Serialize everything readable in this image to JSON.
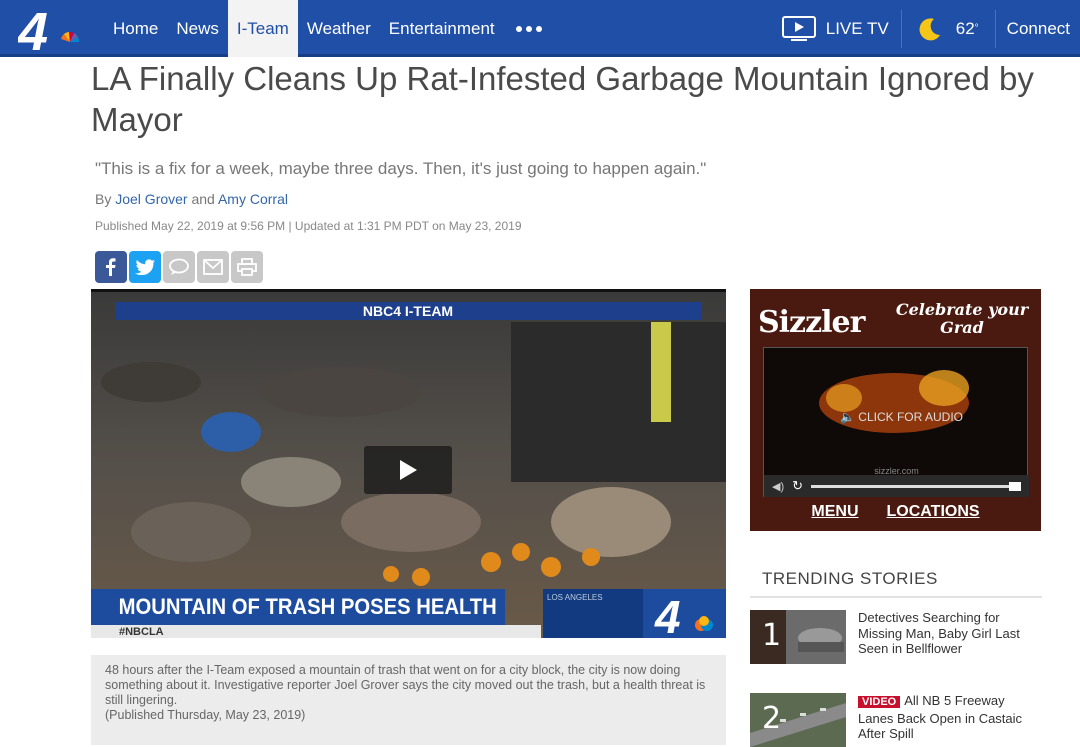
{
  "nav": {
    "items": [
      {
        "label": "Home"
      },
      {
        "label": "News"
      },
      {
        "label": "I-Team"
      },
      {
        "label": "Weather"
      },
      {
        "label": "Entertainment"
      }
    ],
    "active": "I-Team",
    "live_tv": "LIVE TV",
    "temperature": "62",
    "temperature_unit": "°",
    "connect": "Connect",
    "brand_color": "#1f4fa6"
  },
  "article": {
    "headline": "LA Finally Cleans Up Rat-Infested Garbage Mountain Ignored by Mayor",
    "deck": "\"This is a fix for a week, maybe three days. Then, it's just going to happen again.\"",
    "byline_prefix": "By",
    "author1": "Joel Grover",
    "byline_and": "and",
    "author2": "Amy Corral",
    "published": "Published May 22, 2019 at 9:56 PM | Updated at 1:31 PM PDT on May 23, 2019"
  },
  "share": {
    "icons": [
      "facebook-icon",
      "twitter-icon",
      "comment-icon",
      "email-icon",
      "print-icon"
    ],
    "colors": {
      "facebook": "#3b5998",
      "twitter": "#1da1f2",
      "disabled": "#c8c8c8"
    }
  },
  "video": {
    "header": "NBC4 I-TEAM",
    "lower_third": "MOUNTAIN OF TRASH POSES HEALTH HAZARD",
    "hashtag": "#NBCLA",
    "location": "LOS ANGELES",
    "caption": "48 hours after the I-Team exposed a mountain of trash that went on for a city block, the city is now doing something about it. Investigative reporter Joel Grover says the city moved out the trash, but a health threat is still lingering.",
    "caption_date": "(Published Thursday, May 23, 2019)"
  },
  "ad": {
    "brand": "Sizzler",
    "tagline": "Celebrate your Grad",
    "audio_prompt": "CLICK FOR AUDIO",
    "domain": "sizzler.com",
    "menu_link": "MENU",
    "locations_link": "LOCATIONS"
  },
  "trending": {
    "title": "TRENDING STORIES",
    "items": [
      {
        "rank": "1",
        "badge": "",
        "text": "Detectives Searching for Missing Man, Baby Girl Last Seen in Bellflower"
      },
      {
        "rank": "2",
        "badge": "VIDEO",
        "text": "All NB 5 Freeway Lanes Back Open in Castaic After Spill"
      }
    ]
  }
}
